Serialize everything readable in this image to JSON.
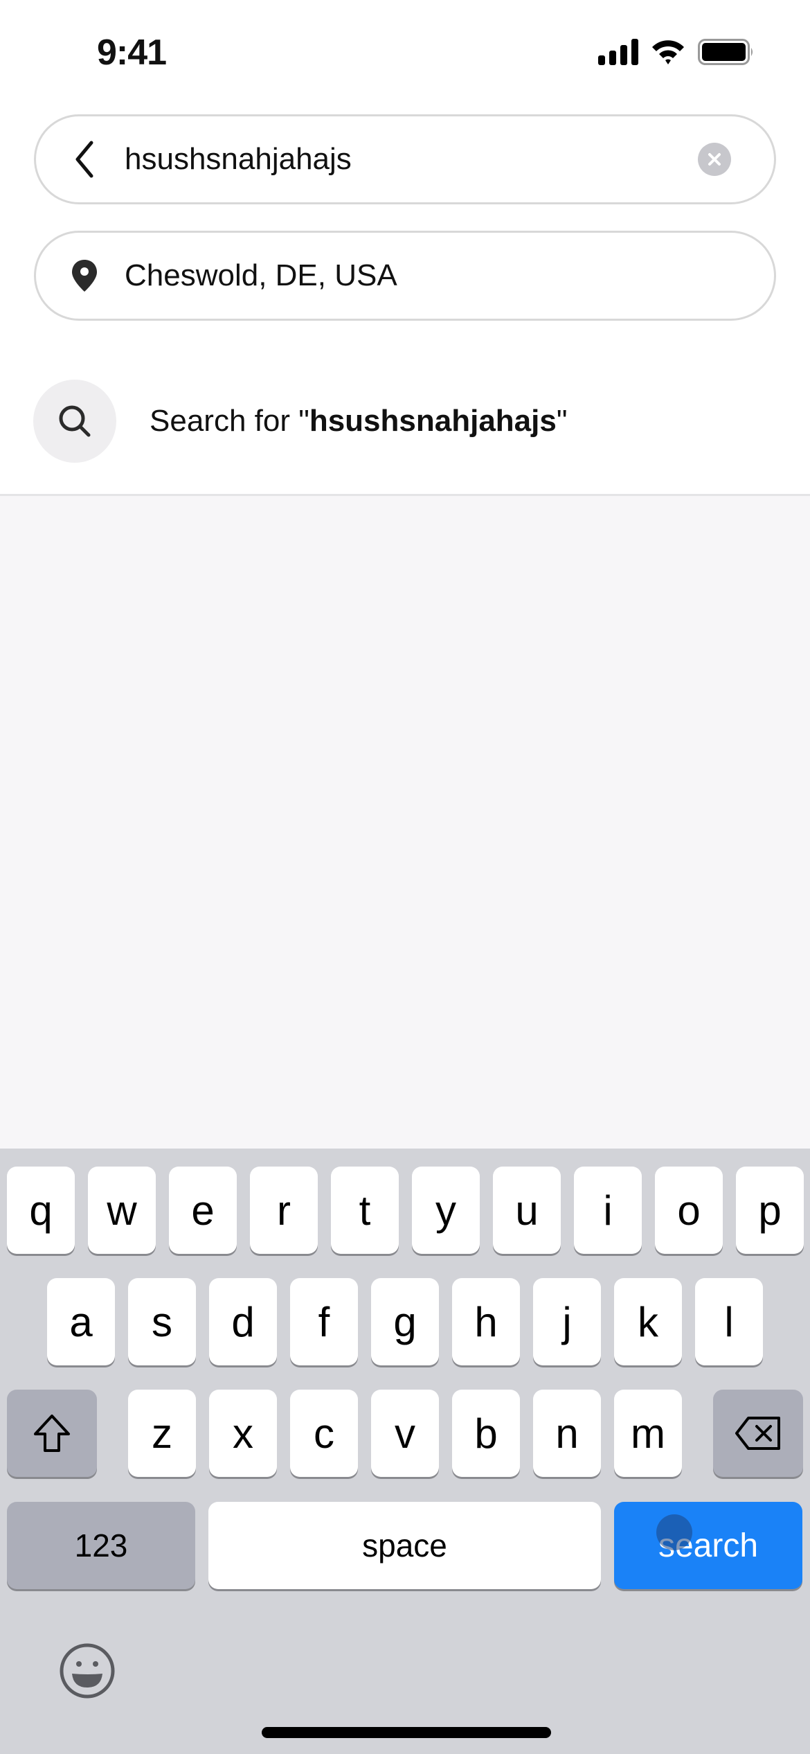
{
  "status_bar": {
    "time": "9:41",
    "icons": [
      "cellular-signal-icon",
      "wifi-icon",
      "battery-icon"
    ]
  },
  "search_field": {
    "value": "hsushsnahjahajs",
    "back_icon": "chevron-left-icon",
    "clear_icon": "clear-x-icon"
  },
  "location_field": {
    "value": "Cheswold, DE, USA",
    "icon": "location-pin-icon"
  },
  "suggestion": {
    "icon": "search-icon",
    "prefix": "Search for \"",
    "query": "hsushsnahjahajs",
    "suffix": "\""
  },
  "keyboard": {
    "row1": [
      "q",
      "w",
      "e",
      "r",
      "t",
      "y",
      "u",
      "i",
      "o",
      "p"
    ],
    "row2": [
      "a",
      "s",
      "d",
      "f",
      "g",
      "h",
      "j",
      "k",
      "l"
    ],
    "row3": [
      "z",
      "x",
      "c",
      "v",
      "b",
      "n",
      "m"
    ],
    "shift_icon": "shift-arrow-icon",
    "delete_icon": "backspace-icon",
    "numbers_label": "123",
    "space_label": "space",
    "return_label": "search",
    "emoji_icon": "emoji-smiley-icon",
    "accent_color": "#1a82f7"
  }
}
